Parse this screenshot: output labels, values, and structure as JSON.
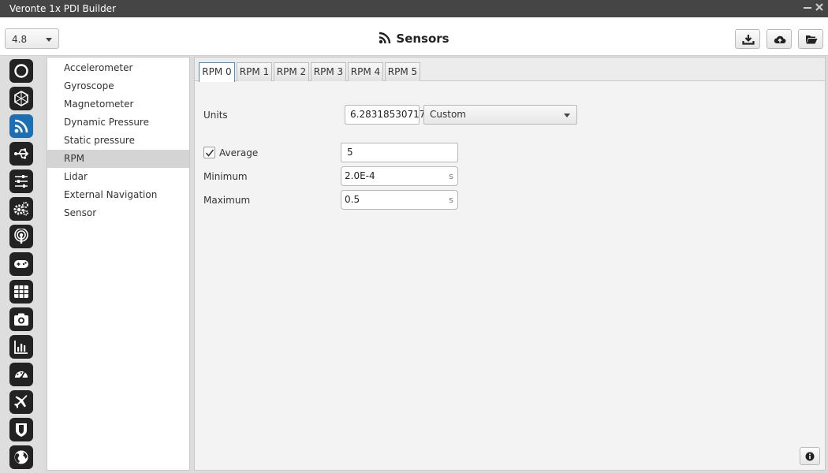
{
  "window": {
    "title": "Veronte 1x PDI Builder"
  },
  "header": {
    "version": "4.8",
    "title": "Sensors"
  },
  "sidebar": {
    "items": [
      {
        "label": "Accelerometer"
      },
      {
        "label": "Gyroscope"
      },
      {
        "label": "Magnetometer"
      },
      {
        "label": "Dynamic Pressure"
      },
      {
        "label": "Static pressure"
      },
      {
        "label": "RPM"
      },
      {
        "label": "Lidar"
      },
      {
        "label": "External Navigation Sensor"
      }
    ],
    "selected": "RPM"
  },
  "tabs": [
    {
      "label": "RPM 0"
    },
    {
      "label": "RPM 1"
    },
    {
      "label": "RPM 2"
    },
    {
      "label": "RPM 3"
    },
    {
      "label": "RPM 4"
    },
    {
      "label": "RPM 5"
    }
  ],
  "form": {
    "units_label": "Units",
    "units_value": "6.28318530717",
    "units_preset": "Custom",
    "average_label": "Average",
    "average_checked": true,
    "average_value": "5",
    "minimum_label": "Minimum",
    "minimum_value": "2.0E-4",
    "minimum_unit": "s",
    "maximum_label": "Maximum",
    "maximum_value": "0.5",
    "maximum_unit": "s"
  },
  "colors": {
    "accent": "#1c6fb3",
    "titlebar": "#454545",
    "icon_bg": "#222222"
  },
  "nav_icons": [
    "power-icon",
    "hexagon-icon",
    "rss-icon",
    "usb-icon",
    "sliders-icon",
    "gears-icon",
    "antenna-icon",
    "gamepad-icon",
    "grid-icon",
    "camera-icon",
    "chart-icon",
    "gauge-icon",
    "plane-icon",
    "shield-icon",
    "globe-icon"
  ]
}
